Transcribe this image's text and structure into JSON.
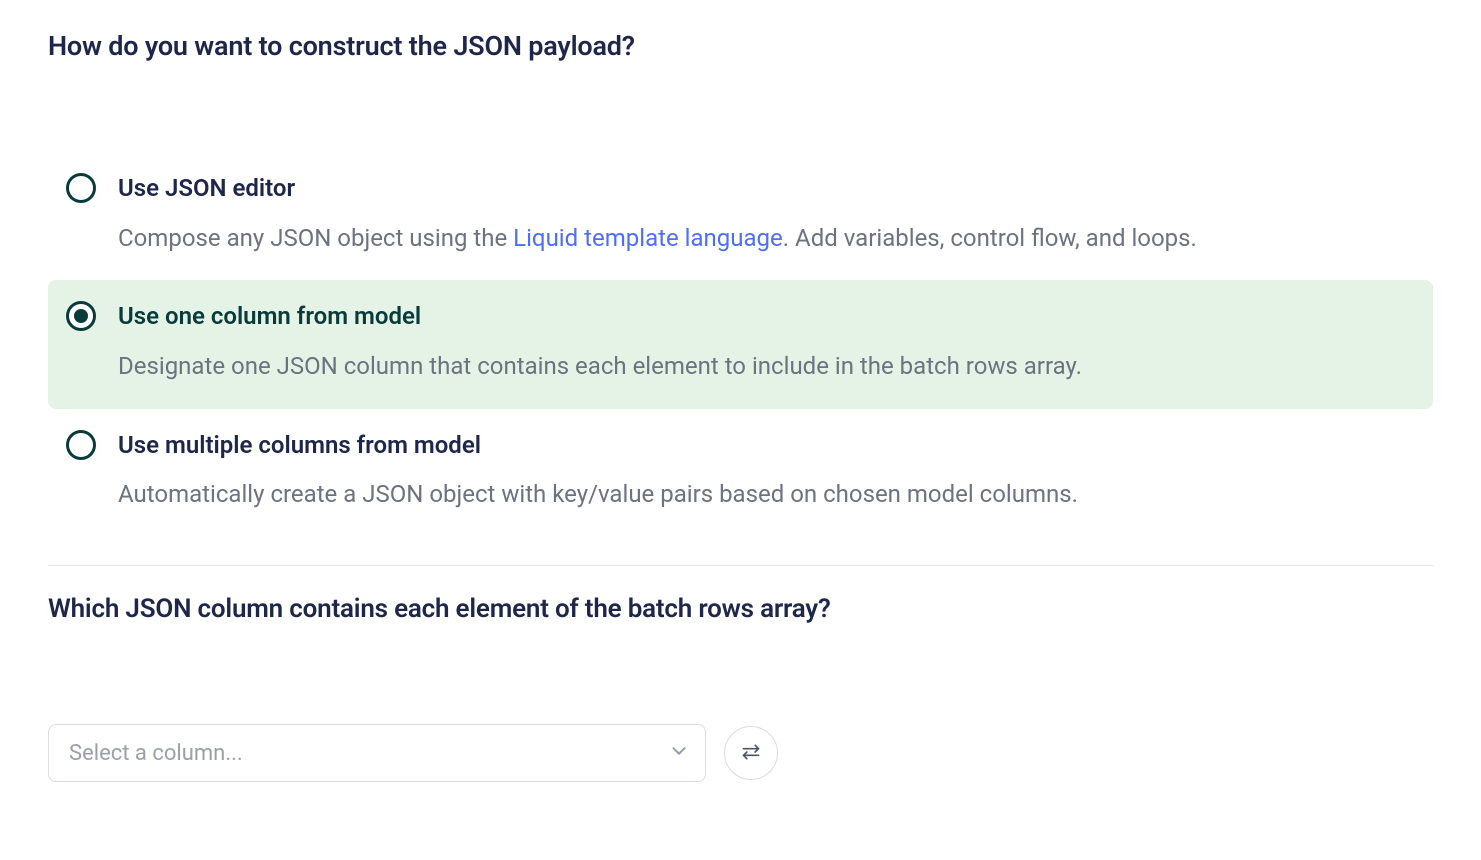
{
  "heading": "How do you want to construct the JSON payload?",
  "options": [
    {
      "title": "Use JSON editor",
      "desc_pre": "Compose any JSON object using the ",
      "link_text": "Liquid template language",
      "desc_post": ". Add variables, control flow, and loops.",
      "selected": false
    },
    {
      "title": "Use one column from model",
      "desc": "Designate one JSON column that contains each element to include in the batch rows array.",
      "selected": true
    },
    {
      "title": "Use multiple columns from model",
      "desc": "Automatically create a JSON object with key/value pairs based on chosen model columns.",
      "selected": false
    }
  ],
  "sub_heading": "Which JSON column contains each element of the batch rows array?",
  "select": {
    "placeholder": "Select a column..."
  }
}
